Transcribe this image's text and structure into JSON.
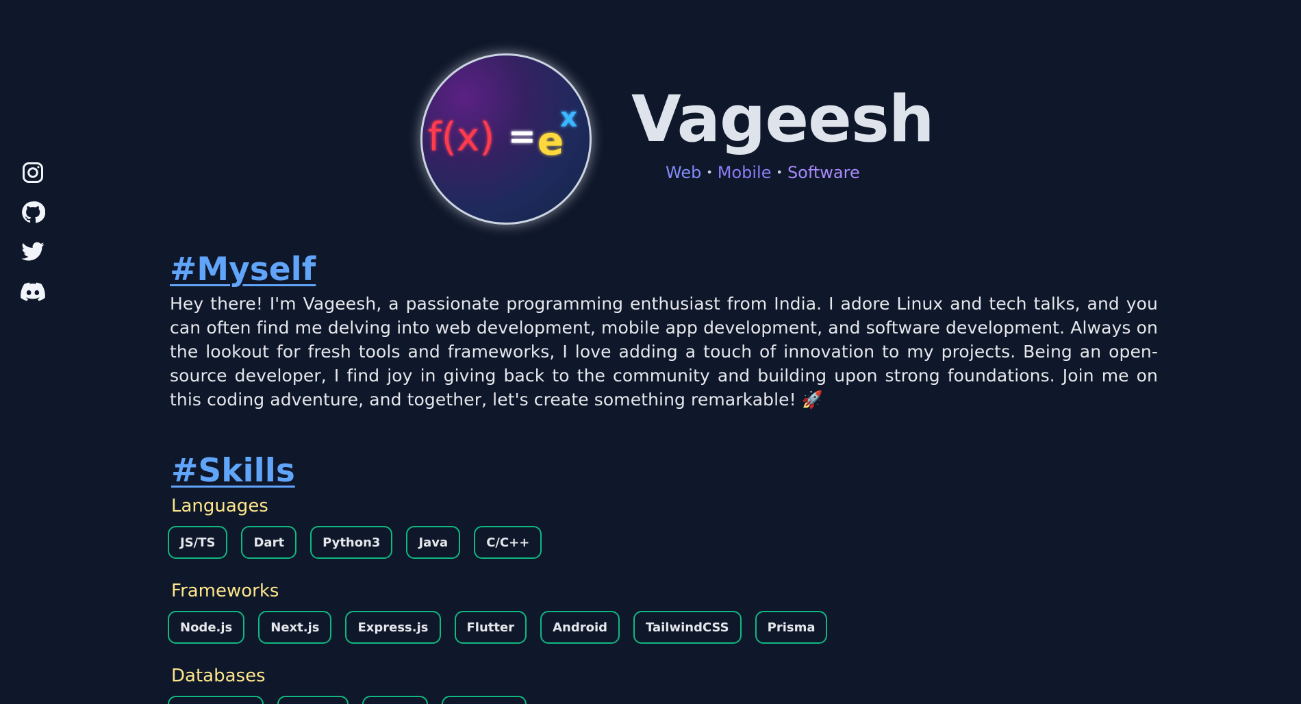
{
  "social": {
    "items": [
      {
        "name": "instagram"
      },
      {
        "name": "github"
      },
      {
        "name": "twitter"
      },
      {
        "name": "discord"
      }
    ]
  },
  "header": {
    "avatar_formula": {
      "fx": "f(x)",
      "eq": "=",
      "base": "e",
      "exp": "x"
    },
    "name": "Vageesh",
    "tagline": {
      "part1": "Web",
      "part2": "Mobile",
      "part3": "Software",
      "separator": "•"
    }
  },
  "about": {
    "title": "#Myself",
    "text": "Hey there! I'm Vageesh, a passionate programming enthusiast from India. I adore Linux and tech talks, and you can often find me delving into web development, mobile app development, and software development. Always on the lookout for fresh tools and frameworks, I love adding a touch of innovation to my projects. Being an open-source developer, I find joy in giving back to the community and building upon strong foundations. Join me on this coding adventure, and together, let's create something remarkable! 🚀"
  },
  "skills": {
    "title": "#Skills",
    "languages": {
      "label": "Languages",
      "items": [
        "JS/TS",
        "Dart",
        "Python3",
        "Java",
        "C/C++"
      ]
    },
    "frameworks": {
      "label": "Frameworks",
      "items": [
        "Node.js",
        "Next.js",
        "Express.js",
        "Flutter",
        "Android",
        "TailwindCSS",
        "Prisma"
      ]
    },
    "databases": {
      "label": "Databases"
    }
  },
  "colors": {
    "background": "#0f172a",
    "heading": "#60a5fa",
    "subheading": "#fde68a",
    "chip_border": "#10b981"
  }
}
